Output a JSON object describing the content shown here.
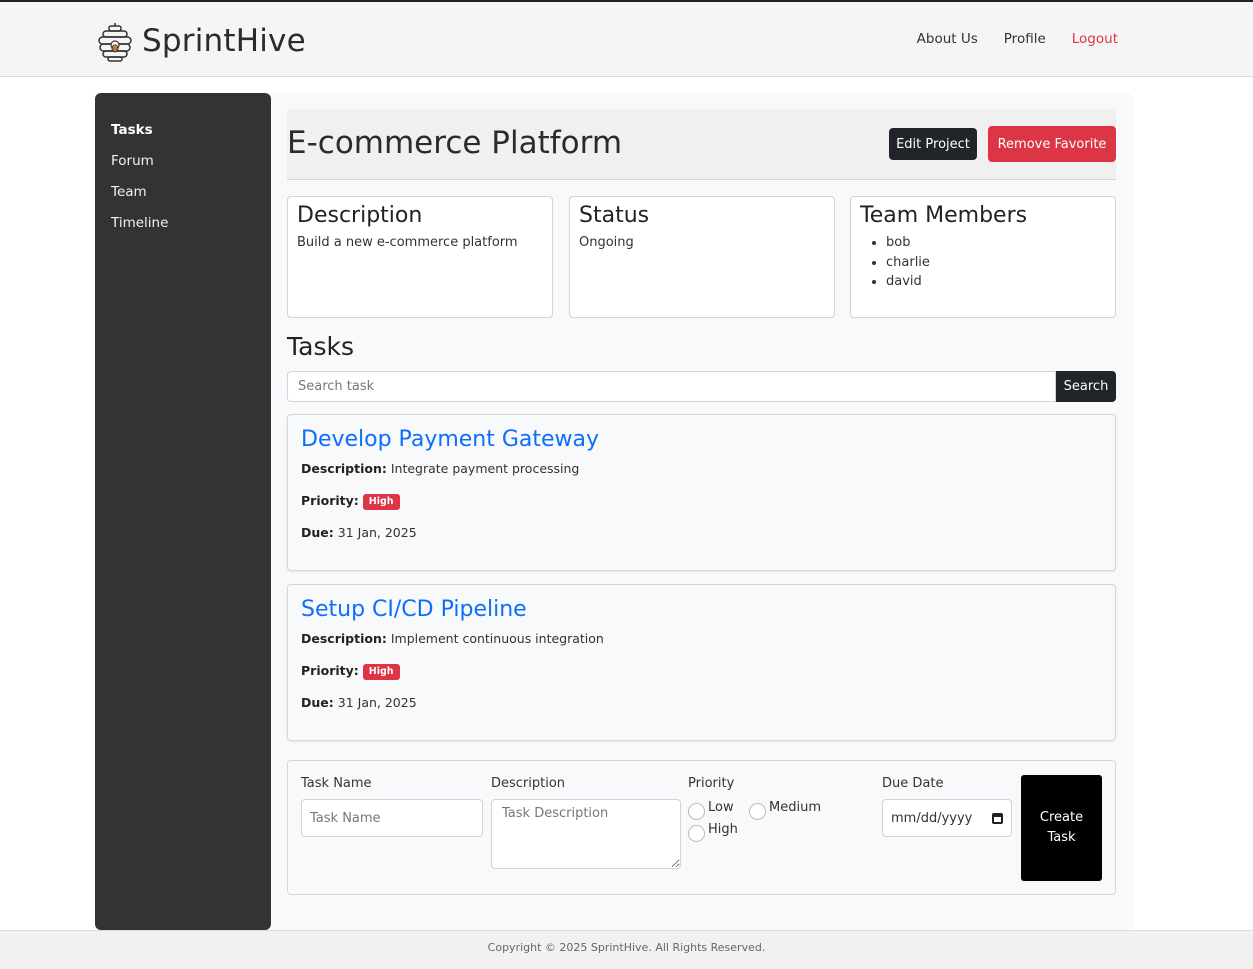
{
  "brand": {
    "name": "SprintHive",
    "logo_icon": "beehive-icon"
  },
  "nav": {
    "about": "About Us",
    "profile": "Profile",
    "logout": "Logout"
  },
  "sidebar": {
    "items": [
      {
        "label": "Tasks",
        "active": true
      },
      {
        "label": "Forum"
      },
      {
        "label": "Team"
      },
      {
        "label": "Timeline"
      }
    ]
  },
  "project": {
    "title": "E-commerce Platform",
    "edit_label": "Edit Project",
    "remove_fav_label": "Remove Favorite"
  },
  "cards": {
    "description": {
      "heading": "Description",
      "text": "Build a new e-commerce platform"
    },
    "status": {
      "heading": "Status",
      "text": "Ongoing"
    },
    "team": {
      "heading": "Team Members",
      "members": [
        "bob",
        "charlie",
        "david"
      ]
    }
  },
  "tasks": {
    "heading": "Tasks",
    "search_placeholder": "Search task",
    "search_label": "Search",
    "labels": {
      "description": "Description:",
      "priority": "Priority:",
      "due": "Due:"
    },
    "items": [
      {
        "title": "Develop Payment Gateway",
        "description": "Integrate payment processing",
        "priority": "High",
        "due": "31 Jan, 2025"
      },
      {
        "title": "Setup CI/CD Pipeline",
        "description": "Implement continuous integration",
        "priority": "High",
        "due": "31 Jan, 2025"
      }
    ]
  },
  "form": {
    "task_name_label": "Task Name",
    "task_name_placeholder": "Task Name",
    "description_label": "Description",
    "description_placeholder": "Task Description",
    "priority_label": "Priority",
    "priority_options": [
      "Low",
      "Medium",
      "High"
    ],
    "due_label": "Due Date",
    "due_placeholder": "mm/dd/yyyy",
    "create_label": "Create Task"
  },
  "footer": {
    "text": "Copyright © 2025 SprintHive. All Rights Reserved."
  },
  "colors": {
    "danger": "#dc3545",
    "link": "#0d6efd",
    "sidebar": "#333333",
    "dark": "#212529"
  }
}
